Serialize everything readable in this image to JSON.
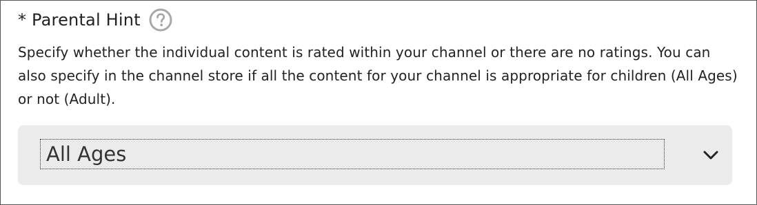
{
  "field": {
    "label": "* Parental Hint",
    "help_icon": "question-circle-icon",
    "description": "Specify whether the individual content is rated within your channel or there are no ratings. You can also specify in the channel store if all the content for your channel is appropriate for children (All Ages) or not (Adult).",
    "select": {
      "value": "All Ages",
      "indicator_icon": "chevron-down-icon"
    }
  },
  "colors": {
    "text": "#222222",
    "select_background": "#ebebeb",
    "help_icon": "#a8a8a8",
    "frame_border": "#555555"
  }
}
